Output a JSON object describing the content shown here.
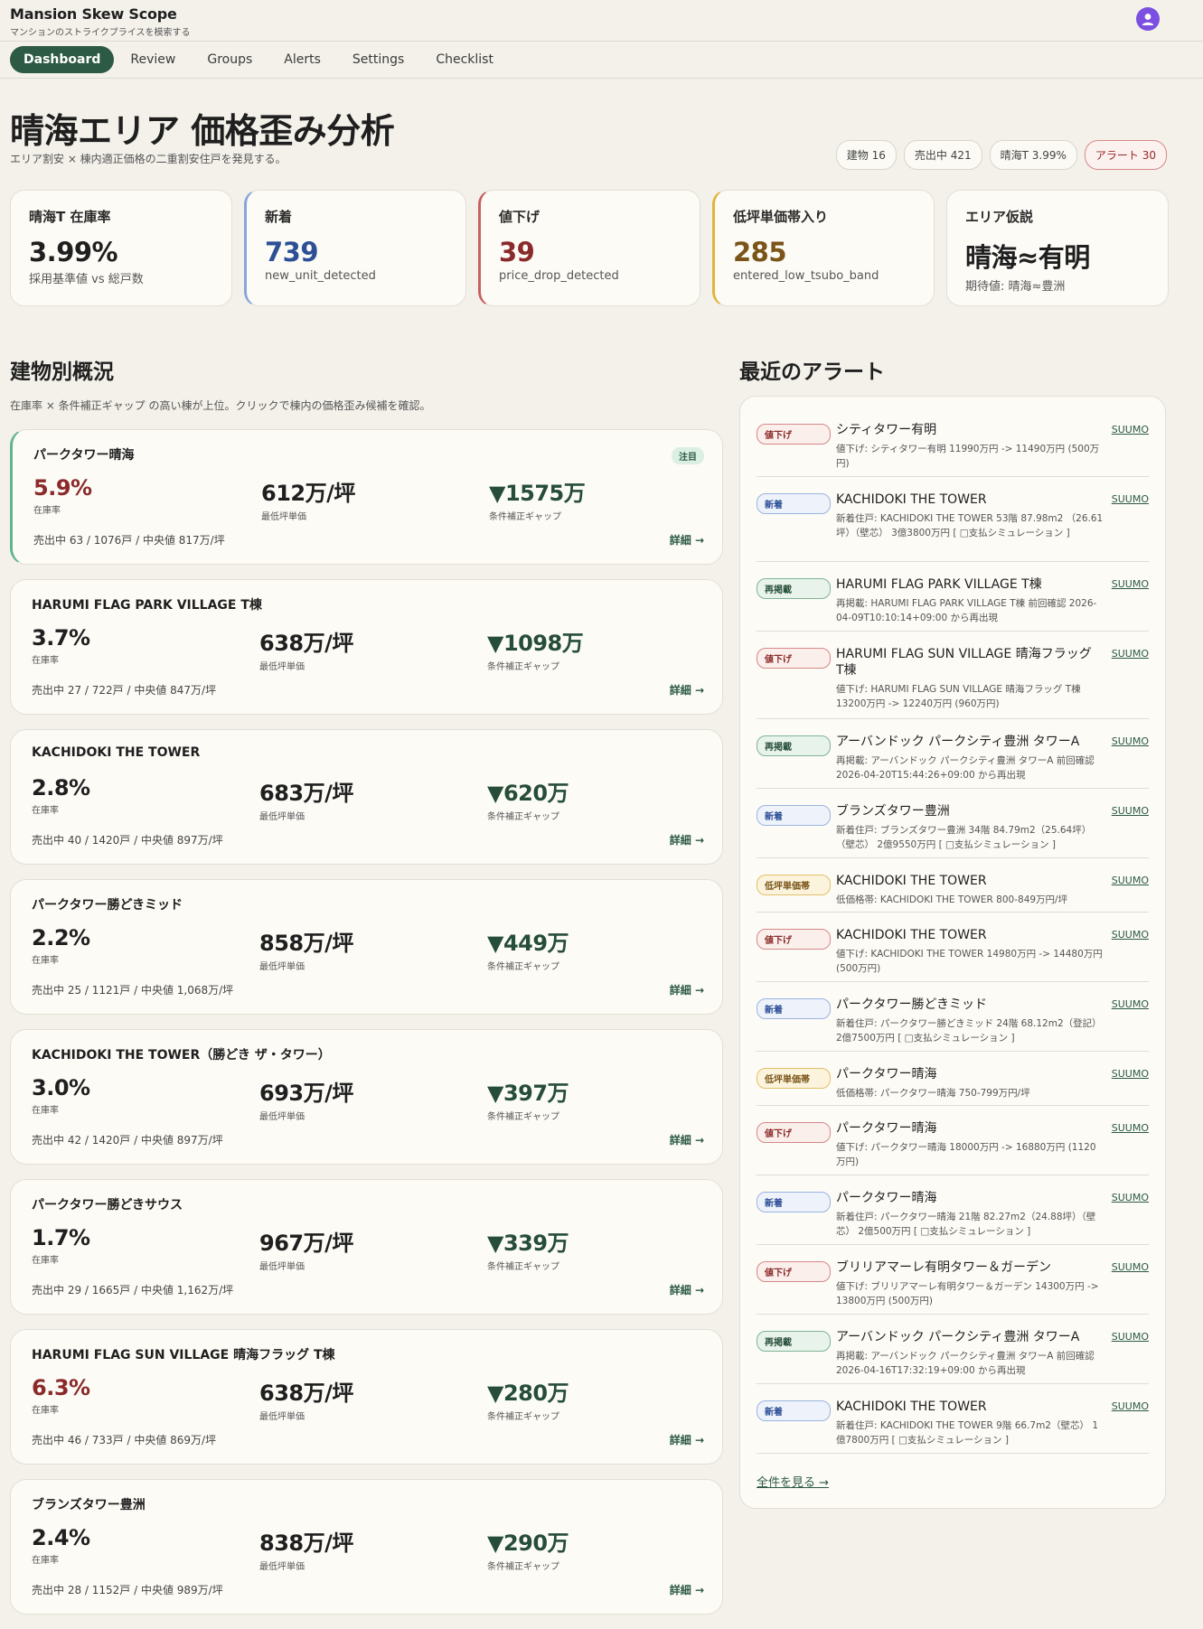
{
  "app": {
    "title": "Mansion Skew Scope",
    "subtitle": "マンションのストライクプライスを模索する"
  },
  "nav": [
    "Dashboard",
    "Review",
    "Groups",
    "Alerts",
    "Settings",
    "Checklist"
  ],
  "header": {
    "title": "晴海エリア 価格歪み分析",
    "subtitle": "エリア割安 × 棟内適正価格の二重割安住戸を発見する。",
    "chips": [
      "建物 16",
      "売出中 421",
      "晴海T 3.99%",
      "アラート 30"
    ]
  },
  "kpis": [
    {
      "label": "晴海T 在庫率",
      "value": "3.99%",
      "desc": "採用基準値 vs 総戸数"
    },
    {
      "label": "新着",
      "value": "739",
      "desc": "new_unit_detected"
    },
    {
      "label": "値下げ",
      "value": "39",
      "desc": "price_drop_detected"
    },
    {
      "label": "低坪単価帯入り",
      "value": "285",
      "desc": "entered_low_tsubo_band"
    },
    {
      "label": "エリア仮説",
      "value": "晴海≈有明",
      "desc": "期待値: 晴海≈豊洲"
    }
  ],
  "buildings": {
    "title": "建物別概況",
    "subtitle": "在庫率 × 条件補正ギャップ の高い棟が上位。クリックで棟内の価格歪み候補を確認。",
    "label_rate": "在庫率",
    "label_min": "最低坪単価",
    "label_gap": "条件補正ギャップ",
    "attention_badge": "注目",
    "detail_label": "詳細 →",
    "items": [
      {
        "name": "パークタワー晴海",
        "rate": "5.9%",
        "min": "612万/坪",
        "gap": "▼1575万",
        "foot": "売出中 63 / 1076戸 / 中央値 817万/坪"
      },
      {
        "name": "HARUMI FLAG PARK VILLAGE T棟",
        "rate": "3.7%",
        "min": "638万/坪",
        "gap": "▼1098万",
        "foot": "売出中 27 / 722戸 / 中央値 847万/坪"
      },
      {
        "name": "KACHIDOKI THE TOWER",
        "rate": "2.8%",
        "min": "683万/坪",
        "gap": "▼620万",
        "foot": "売出中 40 / 1420戸 / 中央値 897万/坪"
      },
      {
        "name": "パークタワー勝どきミッド",
        "rate": "2.2%",
        "min": "858万/坪",
        "gap": "▼449万",
        "foot": "売出中 25 / 1121戸 / 中央値 1,068万/坪"
      },
      {
        "name": "KACHIDOKI THE TOWER（勝どき ザ・タワー）",
        "rate": "3.0%",
        "min": "693万/坪",
        "gap": "▼397万",
        "foot": "売出中 42 / 1420戸 / 中央値 897万/坪"
      },
      {
        "name": "パークタワー勝どきサウス",
        "rate": "1.7%",
        "min": "967万/坪",
        "gap": "▼339万",
        "foot": "売出中 29 / 1665戸 / 中央値 1,162万/坪"
      },
      {
        "name": "HARUMI FLAG SUN VILLAGE 晴海フラッグ T棟",
        "rate": "6.3%",
        "min": "638万/坪",
        "gap": "▼280万",
        "foot": "売出中 46 / 733戸 / 中央値 869万/坪"
      },
      {
        "name": "ブランズタワー豊洲",
        "rate": "2.4%",
        "min": "838万/坪",
        "gap": "▼290万",
        "foot": "売出中 28 / 1152戸 / 中央値 989万/坪"
      }
    ]
  },
  "alerts": {
    "title": "最近のアラート",
    "link_label": "SUUMO",
    "see_all": "全件を見る →",
    "items": [
      {
        "type": "値下げ",
        "title": "シティタワー有明",
        "detail": "値下げ: シティタワー有明 11990万円 -> 11490万円 (500万円)"
      },
      {
        "type": "新着",
        "title": "KACHIDOKI THE TOWER",
        "detail": "新着住戸: KACHIDOKI THE TOWER 53階 87.98m2 （26.61坪）（壁芯） 3億3800万円 [ □支払シミュレーション ]"
      },
      {
        "type": "再掲載",
        "title": "HARUMI FLAG PARK VILLAGE T棟",
        "detail": "再掲載: HARUMI FLAG PARK VILLAGE T棟 前回確認 2026-04-09T10:10:14+09:00 から再出現"
      },
      {
        "type": "値下げ",
        "title": "HARUMI FLAG SUN VILLAGE 晴海フラッグ T棟",
        "detail": "値下げ: HARUMI FLAG SUN VILLAGE 晴海フラッグ T棟 13200万円 -> 12240万円 (960万円)"
      },
      {
        "type": "再掲載",
        "title": "アーバンドック パークシティ豊洲 タワーA",
        "detail": "再掲載: アーバンドック パークシティ豊洲 タワーA 前回確認 2026-04-20T15:44:26+09:00 から再出現"
      },
      {
        "type": "新着",
        "title": "ブランズタワー豊洲",
        "detail": "新着住戸: ブランズタワー豊洲 34階 84.79m2（25.64坪）（壁芯） 2億9550万円 [ □支払シミュレーション ]"
      },
      {
        "type": "低坪単価帯",
        "title": "KACHIDOKI THE TOWER",
        "detail": "低価格帯: KACHIDOKI THE TOWER 800-849万円/坪"
      },
      {
        "type": "値下げ",
        "title": "KACHIDOKI THE TOWER",
        "detail": "値下げ: KACHIDOKI THE TOWER 14980万円 -> 14480万円 (500万円)"
      },
      {
        "type": "新着",
        "title": "パークタワー勝どきミッド",
        "detail": "新着住戸: パークタワー勝どきミッド 24階 68.12m2（登記） 2億7500万円 [ □支払シミュレーション ]"
      },
      {
        "type": "低坪単価帯",
        "title": "パークタワー晴海",
        "detail": "低価格帯: パークタワー晴海 750-799万円/坪"
      },
      {
        "type": "値下げ",
        "title": "パークタワー晴海",
        "detail": "値下げ: パークタワー晴海 18000万円 -> 16880万円 (1120万円)"
      },
      {
        "type": "新着",
        "title": "パークタワー晴海",
        "detail": "新着住戸: パークタワー晴海 21階 82.27m2（24.88坪）（壁芯） 2億500万円 [ □支払シミュレーション ]"
      },
      {
        "type": "値下げ",
        "title": "ブリリアマーレ有明タワー＆ガーデン",
        "detail": "値下げ: ブリリアマーレ有明タワー＆ガーデン 14300万円 -> 13800万円 (500万円)"
      },
      {
        "type": "再掲載",
        "title": "アーバンドック パークシティ豊洲 タワーA",
        "detail": "再掲載: アーバンドック パークシティ豊洲 タワーA 前回確認 2026-04-16T17:32:19+09:00 から再出現"
      },
      {
        "type": "新着",
        "title": "KACHIDOKI THE TOWER",
        "detail": "新着住戸: KACHIDOKI THE TOWER 9階 66.7m2（壁芯） 1億7800万円 [ □支払シミュレーション ]"
      }
    ]
  }
}
